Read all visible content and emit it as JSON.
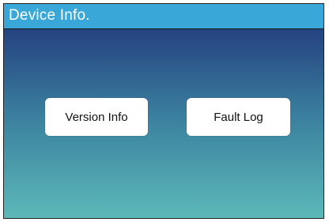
{
  "window": {
    "title": "Device Info."
  },
  "buttons": {
    "version_info": "Version Info",
    "fault_log": "Fault Log"
  },
  "colors": {
    "title_bar": "#3aa7d9",
    "gradient_top": "#1f3178",
    "gradient_bottom": "#5cb9b8",
    "button_bg": "#ffffff"
  }
}
